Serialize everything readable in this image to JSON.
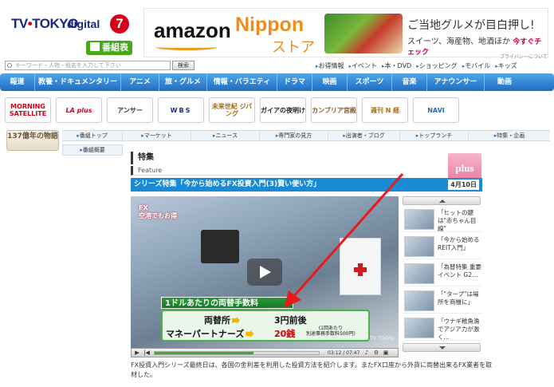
{
  "header": {
    "logo_tv": "TV",
    "logo_tokyo": "TOKYO",
    "logo_digital": "digital",
    "logo_seven": "7",
    "bangumi_label": "番組表"
  },
  "banner": {
    "brand": "amazon",
    "nippon": "Nippon",
    "store": "ストア",
    "catch": "ご当地グルメが目白押し!",
    "sub": "スイーツ、海産物、地酒ほか ",
    "check": "今すぐチェック",
    "privacy": "プライバシーについて"
  },
  "search": {
    "placeholder": "キーワード・人物・役名を入力して下さい",
    "button": "検索"
  },
  "toplinks": [
    "お得情報",
    "イベント",
    "本・DVD",
    "ショッピング",
    "モバイル",
    "キッズ"
  ],
  "mainnav": [
    "報道",
    "教養・ドキュメンタリー",
    "アニメ",
    "旅・グルメ",
    "情報・バラエティ",
    "ドラマ",
    "映画",
    "スポーツ",
    "音楽",
    "アナウンサー",
    "動画"
  ],
  "programs": [
    "MORNING SATELLITE",
    "LA plus",
    "アンサー",
    "WBS",
    "未来世紀 ジパング",
    "ガイアの夜明け",
    "カンブリア宮殿",
    "週刊 N 経",
    "NAVI"
  ],
  "subnav": [
    "番組トップ",
    "マーケット",
    "ニュース",
    "専門家の見方",
    "出演者・ブログ",
    "トップランチ",
    "特集・企画"
  ],
  "subnav2": "番組概要",
  "anniversary": "137億年の物語",
  "section": {
    "title": "特集",
    "sub": "Feature",
    "plus": "plus"
  },
  "article": {
    "title": "シリーズ特集「今から始めるFX投資入門(3)賢い使い方」",
    "date": "4月10日"
  },
  "video": {
    "fx_line1": "FX",
    "fx_line2": "空港でもお得",
    "caption_title": "1ドルあたりの両替手数料",
    "row1_label": "両替所",
    "row1_value": "3円前後",
    "row2_label": "マネーパートナーズ",
    "row2_value": "20銭",
    "note_line1": "(1回あたり",
    "note_line2": "別途事務手数料500円)",
    "watermark": "TV TOKYO",
    "time": "03:12 / 07:47",
    "progress": 0.6
  },
  "description": "FX投資入門シリーズ最終日は、各国の金利差を利用した投資方法を紹介します。またFX口座から外貨に両替出来るFX業者を取材した。",
  "related": [
    "「ヒットの鍵は\"赤ちゃん目線\"",
    "「今から始めるREIT入門」",
    "「為替特集 重要イベント G2…",
    "「\"タープ\"は場所を商機に」",
    "「ウナギ稚魚漁でアジア力が激く…"
  ],
  "colors": {
    "nav_blue": "#1e6cc4",
    "article_bar": "#1a8ad4",
    "annotation_arrow": "#e81a1a",
    "caption_green": "#2a9a3a"
  }
}
